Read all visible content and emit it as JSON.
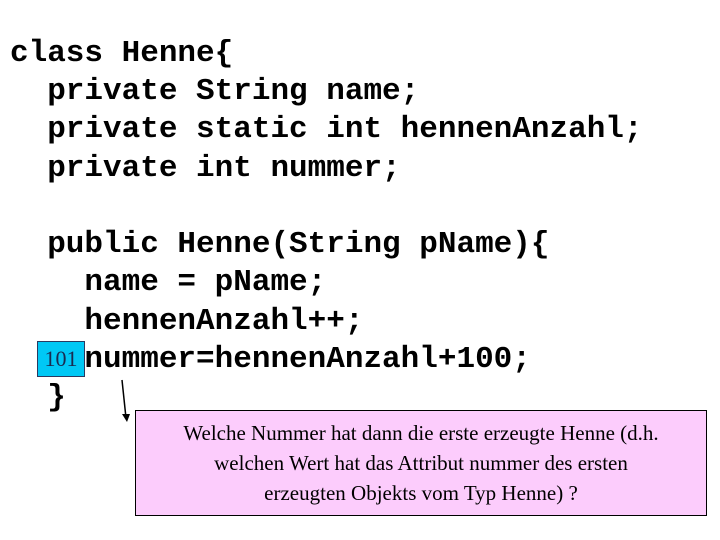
{
  "code": {
    "lines": [
      "class Henne{",
      "  private String name;",
      "  private static int hennenAnzahl;",
      "  private int nummer;",
      "",
      "  public Henne(String pName){",
      "    name = pName;",
      "    hennenAnzahl++;",
      "    nummer=hennenAnzahl+100;",
      "  }"
    ]
  },
  "badge": {
    "value": "101",
    "color": "#00c8f5"
  },
  "callout": {
    "lines": [
      "Welche Nummer hat dann die erste erzeugte Henne (d.h.",
      "welchen Wert hat das Attribut nummer des ersten",
      "erzeugten Objekts vom Typ Henne) ?"
    ],
    "background": "#fcccfc"
  }
}
